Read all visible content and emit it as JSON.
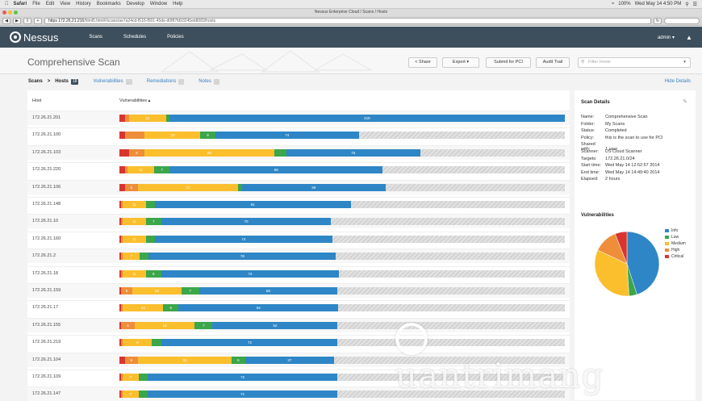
{
  "macmenu": {
    "apple": "",
    "items": [
      "Safari",
      "File",
      "Edit",
      "View",
      "History",
      "Bookmarks",
      "Develop",
      "Window",
      "Help"
    ],
    "clock": "Wed May 14  4:50 PM",
    "battery": "100%"
  },
  "window": {
    "title": "Nessus Enterprise Cloud / Scans / Hosts"
  },
  "browser": {
    "url_host": "https  172.26.21.216",
    "url_path": "/html5.html#/scans/ae7a24cd-f516-f501-45de-d0f87fd93245eb8083/hosts"
  },
  "nav": {
    "logo": "Nessus",
    "links": [
      "Scans",
      "Schedules",
      "Policies"
    ],
    "user": "admin ▾"
  },
  "header": {
    "title": "Comprehensive Scan",
    "share": "< Share",
    "export": "Export ▾",
    "submit_pci": "Submit for PCI",
    "audit_trail": "Audit Trail",
    "filter_placeholder": "Filter Hosts"
  },
  "subnav": {
    "scans": "Scans",
    "sep": ">",
    "hosts": "Hosts",
    "hosts_count": "18",
    "vulnerabilities": "Vulnerabilities",
    "remediations": "Remediations",
    "notes": "Notes",
    "hide_details": "Hide Details"
  },
  "table": {
    "col_host": "Host",
    "col_vuln": "Vulnerabilities ▴",
    "rows": [
      {
        "host": "172.26.21.201",
        "critical": 0.012,
        "high": 0.009,
        "medium": 0.084,
        "low": 0.007,
        "info": 0.888,
        "labels": {
          "medium": "23",
          "info": "218"
        }
      },
      {
        "host": "172.26.21.100",
        "critical": 0.012,
        "high": 0.045,
        "medium": 0.125,
        "low": 0.033,
        "info": 0.323,
        "labels": {
          "high": "",
          "medium": "23",
          "low": "8",
          "info": "74"
        }
      },
      {
        "host": "172.26.21.103",
        "critical": 0.021,
        "high": 0.036,
        "medium": 0.29,
        "low": 0.028,
        "info": 0.3,
        "labels": {
          "high": "8",
          "medium": "53",
          "info": "75"
        }
      },
      {
        "host": "172.26.21.220",
        "critical": 0.012,
        "high": 0.006,
        "medium": 0.06,
        "low": 0.035,
        "info": 0.478,
        "labels": {
          "medium": "11",
          "low": "7",
          "info": "88"
        }
      },
      {
        "host": "172.26.21.106",
        "critical": 0.012,
        "high": 0.03,
        "medium": 0.224,
        "low": 0.01,
        "info": 0.321,
        "labels": {
          "high": "6",
          "medium": "37",
          "info": "59"
        }
      },
      {
        "host": "172.26.21.148",
        "critical": 0.004,
        "high": 0.004,
        "medium": 0.051,
        "low": 0.02,
        "info": 0.441,
        "labels": {
          "medium": "11",
          "info": "81"
        }
      },
      {
        "host": "172.26.21.10",
        "critical": 0.004,
        "high": 0.004,
        "medium": 0.051,
        "low": 0.035,
        "info": 0.381,
        "labels": {
          "medium": "11",
          "low": "7",
          "info": "70"
        }
      },
      {
        "host": "172.26.21.160",
        "critical": 0.004,
        "high": 0.004,
        "medium": 0.051,
        "low": 0.02,
        "info": 0.4,
        "labels": {
          "medium": "11",
          "info": "74"
        }
      },
      {
        "host": "172.26.21.2",
        "critical": 0.004,
        "high": 0.004,
        "medium": 0.038,
        "low": 0.02,
        "info": 0.42,
        "labels": {
          "medium": "7",
          "info": "78"
        }
      },
      {
        "host": "172.26.21.18",
        "critical": 0.004,
        "high": 0.004,
        "medium": 0.051,
        "low": 0.035,
        "info": 0.399,
        "labels": {
          "medium": "11",
          "low": "8",
          "info": "74"
        }
      },
      {
        "host": "172.26.21.159",
        "critical": 0.004,
        "high": 0.025,
        "medium": 0.11,
        "low": 0.04,
        "info": 0.31,
        "labels": {
          "high": "6",
          "medium": "22",
          "low": "7",
          "info": "58"
        }
      },
      {
        "host": "172.26.21.17",
        "critical": 0.004,
        "high": 0.004,
        "medium": 0.09,
        "low": 0.035,
        "info": 0.358,
        "labels": {
          "medium": "14",
          "low": "6",
          "info": "64"
        }
      },
      {
        "host": "172.26.21.155",
        "critical": 0.004,
        "high": 0.03,
        "medium": 0.135,
        "low": 0.04,
        "info": 0.281,
        "labels": {
          "high": "6",
          "medium": "18",
          "low": "7",
          "info": "52"
        }
      },
      {
        "host": "172.26.21.219",
        "critical": 0.004,
        "high": 0.004,
        "medium": 0.065,
        "low": 0.022,
        "info": 0.395,
        "labels": {
          "medium": "9",
          "info": "72"
        }
      },
      {
        "host": "172.26.21.104",
        "critical": 0.012,
        "high": 0.03,
        "medium": 0.21,
        "low": 0.03,
        "info": 0.2,
        "labels": {
          "high": "6",
          "medium": "31",
          "low": "6",
          "info": "37"
        }
      },
      {
        "host": "172.26.21.109",
        "critical": 0.004,
        "high": 0.004,
        "medium": 0.035,
        "low": 0.02,
        "info": 0.427,
        "labels": {
          "medium": "7",
          "info": "72"
        }
      },
      {
        "host": "172.26.21.147",
        "critical": 0.004,
        "high": 0.004,
        "medium": 0.035,
        "low": 0.02,
        "info": 0.427,
        "labels": {
          "medium": "7",
          "info": "71"
        }
      }
    ]
  },
  "details": {
    "title": "Scan Details",
    "items": [
      {
        "k": "Name:",
        "v": "Comprehensive Scan"
      },
      {
        "k": "Folder:",
        "v": "My Scans"
      },
      {
        "k": "Status:",
        "v": "Completed"
      },
      {
        "k": "Policy:",
        "v": "this is the scan to use for PCI"
      },
      {
        "k": "Shared with:",
        "v": "1 user"
      },
      {
        "k": "Scanner:",
        "v": "US Cloud Scanner"
      },
      {
        "k": "Targets:",
        "v": "172.26.21.0/24"
      },
      {
        "k": "Start time:",
        "v": "Wed May 14 12:52:57 2014"
      },
      {
        "k": "End time:",
        "v": "Wed May 14 14:49:40 2014"
      },
      {
        "k": "Elapsed:",
        "v": "2 hours"
      }
    ],
    "vuln_title": "Vulnerabilities",
    "legend": [
      {
        "name": "Info",
        "color": "#2e86c6"
      },
      {
        "name": "Low",
        "color": "#3ba64a"
      },
      {
        "name": "Medium",
        "color": "#fbbf2e"
      },
      {
        "name": "High",
        "color": "#ee8e3a"
      },
      {
        "name": "Critical",
        "color": "#d9352f"
      }
    ],
    "pie": [
      {
        "name": "Info",
        "value": 0.45
      },
      {
        "name": "Low",
        "value": 0.04
      },
      {
        "name": "Medium",
        "value": 0.33
      },
      {
        "name": "High",
        "value": 0.12
      },
      {
        "name": "Critical",
        "value": 0.06
      }
    ]
  },
  "colors": {
    "critical": "#d9352f",
    "high": "#ee8e3a",
    "medium": "#fbbf2e",
    "low": "#3ba64a",
    "info": "#2e86c6"
  },
  "watermark": "uantrimang"
}
